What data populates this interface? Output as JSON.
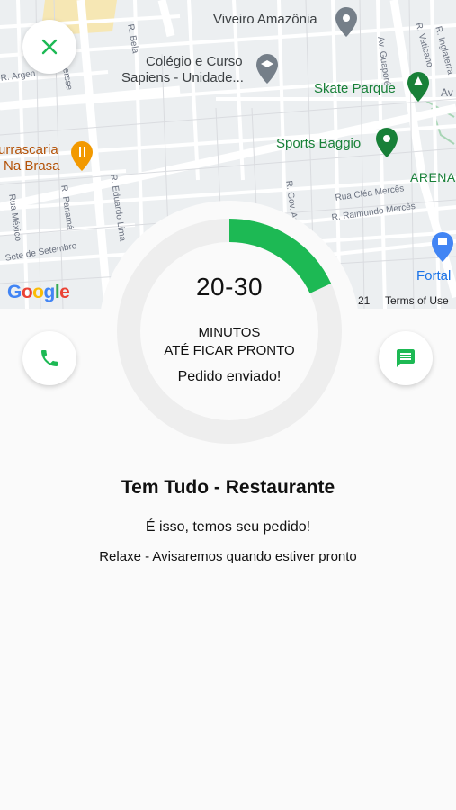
{
  "map": {
    "labels": {
      "viveiro": "Viveiro Amazônia",
      "colegio_line1": "Colégio e Curso",
      "colegio_line2": "Sapiens - Unidade...",
      "skate": "Skate Parque",
      "sports": "Sports Baggio",
      "arena": "ARENA",
      "churrascaria_line1": "urrascaria",
      "churrascaria_line2": "Na Brasa",
      "fortal": "Fortal",
      "street_guapore": "Av. Guaporé",
      "street_vaticano": "R. Vaticano",
      "street_inglaterra": "R. Inglaterra",
      "street_bela": "R. Bela",
      "street_ersse": "ersse",
      "street_argentina": "R. Argen",
      "street_panama": "R. Panamá",
      "street_mexico": "Rua México",
      "street_eduardo": "R. Eduardo Lima",
      "street_sete": "Sete de Setembro",
      "street_clea": "Rua Cléa Mercês",
      "street_raimundo": "R. Raimundo Mercês",
      "street_gov": "R. Gov. Ar",
      "street_av": "Av"
    },
    "logo": "Google",
    "copyright_fragment": "21",
    "terms": "Terms of Use",
    "colors": {
      "background": "#eceff1",
      "road": "#ffffff",
      "park": "#f6e7b4",
      "poi_green": "#188038",
      "poi_grey": "#757f89",
      "poi_orange": "#f29900",
      "poi_blue": "#4285f4"
    }
  },
  "close_button": {
    "icon": "close-icon"
  },
  "call_button": {
    "icon": "phone-icon"
  },
  "chat_button": {
    "icon": "message-icon"
  },
  "timer": {
    "range": "20-30",
    "unit_line1": "MINUTOS",
    "unit_line2": "ATÉ FICAR PRONTO",
    "status": "Pedido enviado!",
    "progress": 0.18
  },
  "restaurant": {
    "name": "Tem Tudo - Restaurante",
    "message": "É isso, temos seu pedido!",
    "submessage": "Relaxe - Avisaremos quando estiver pronto"
  },
  "colors": {
    "accent": "#1db954",
    "ring_track": "#eeeeee",
    "sheet": "#fafafa"
  }
}
